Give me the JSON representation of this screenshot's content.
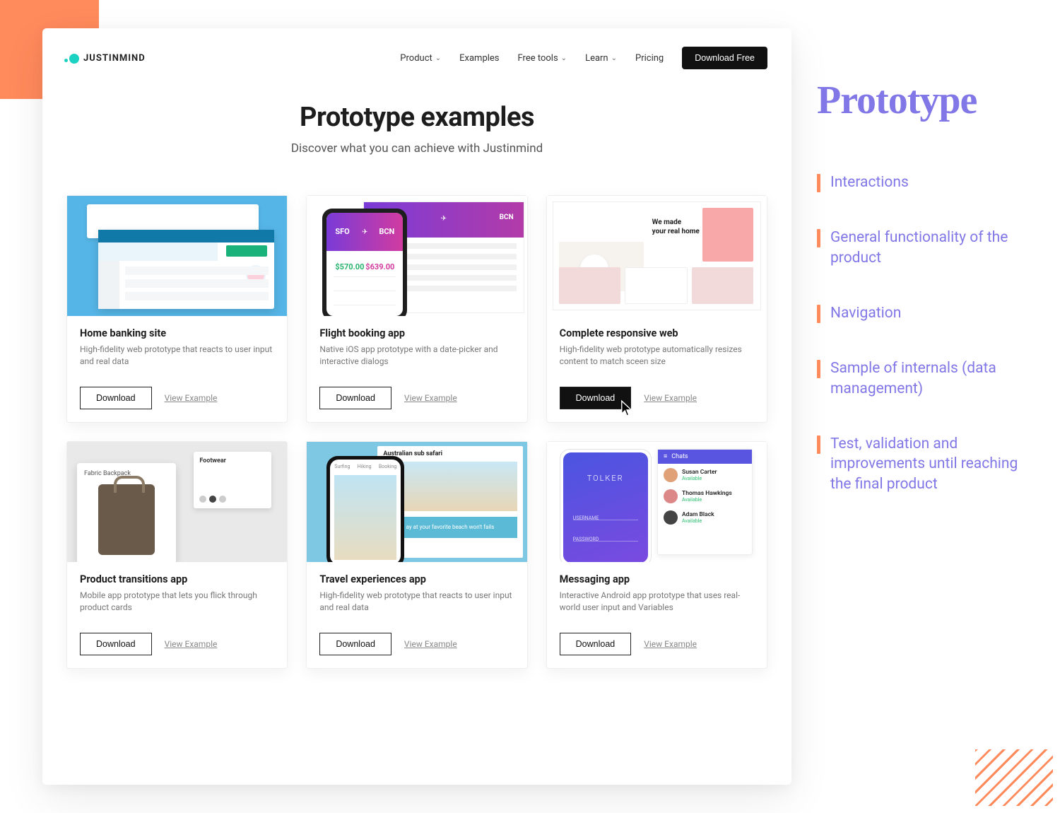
{
  "brand": {
    "name": "JUSTINMIND"
  },
  "nav": {
    "product": "Product",
    "examples": "Examples",
    "free_tools": "Free tools",
    "learn": "Learn",
    "pricing": "Pricing",
    "download": "Download Free"
  },
  "hero": {
    "title": "Prototype examples",
    "subtitle": "Discover what you can achieve with Justinmind"
  },
  "labels": {
    "download": "Download",
    "view": "View Example"
  },
  "cards": [
    {
      "title": "Home banking site",
      "desc": "High-fidelity web prototype that reacts to user input and real data"
    },
    {
      "title": "Flight booking app",
      "desc": "Native iOS app prototype with a date-picker and interactive dialogs",
      "codes": {
        "from": "SFO",
        "to": "BCN",
        "price_left": "$570.00",
        "price_right": "$639.00"
      }
    },
    {
      "title": "Complete responsive web",
      "desc": "High-fidelity web prototype automatically resizes content to match sceen size",
      "hero_text": "We made\nyour real home",
      "highlight": true
    },
    {
      "title": "Product transitions app",
      "desc": "Mobile app prototype that lets you flick through product cards",
      "labels": {
        "big": "Fabric Backpack",
        "small": "Footwear"
      }
    },
    {
      "title": "Travel experiences app",
      "desc": "High-fidelity web prototype that reacts to user input and real data",
      "sheet_title": "Australian sub safari",
      "cta": "ay at your favorite beach won't fails",
      "tabs": [
        "Surfing",
        "Hiking",
        "Booking"
      ]
    },
    {
      "title": "Messaging app",
      "desc": "Interactive Android app prototype that uses real-world user input and Variables",
      "logo": "TOLKER",
      "chats_label": "Chats",
      "field_user": "USERNAME",
      "field_pass": "PASSWORD",
      "contacts": [
        {
          "name": "Susan Carter",
          "status": "Available",
          "color": "#e0a078"
        },
        {
          "name": "Thomas Hawkings",
          "status": "Available",
          "color": "#d88"
        },
        {
          "name": "Adam Black",
          "status": "Available",
          "color": "#444"
        }
      ]
    }
  ],
  "explainer": {
    "heading": "Prototype",
    "bullets": [
      "Interactions",
      "General functionality of the product",
      "Navigation",
      "Sample of internals (data management)",
      "Test, validation and improvements until reaching the final product"
    ]
  }
}
